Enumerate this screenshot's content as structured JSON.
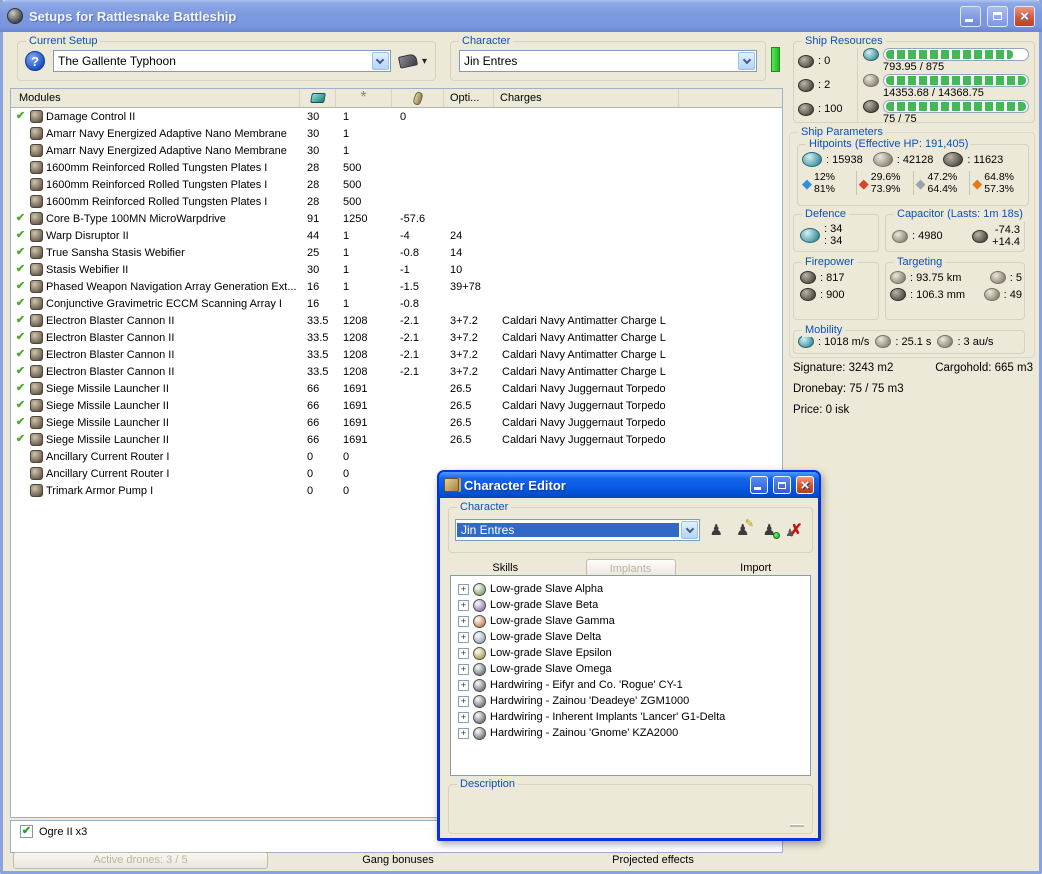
{
  "icons": {
    "help": "?",
    "dropdown_arrow": "▾",
    "fitted_check": "✔",
    "close_x": "×",
    "expander_plus": "+",
    "person": "♟",
    "edit_pencil": "✎",
    "delete_x": "✗",
    "resist_diamond": "◆"
  },
  "main_window": {
    "title": "Setups for Rattlesnake Battleship",
    "current_setup": {
      "label": "Current Setup",
      "value": "The Gallente Typhoon"
    },
    "character": {
      "label": "Character",
      "value": "Jin Entres"
    }
  },
  "modules_table": {
    "headers": {
      "name": "Modules",
      "opti": "Opti...",
      "charges": "Charges"
    },
    "rows": [
      {
        "checked": true,
        "name": "Damage Control II",
        "cpu": "30",
        "pg": "1",
        "cap": "0",
        "opti": "",
        "charge": ""
      },
      {
        "checked": false,
        "name": "Amarr Navy Energized Adaptive Nano Membrane",
        "cpu": "30",
        "pg": "1",
        "cap": "",
        "opti": "",
        "charge": ""
      },
      {
        "checked": false,
        "name": "Amarr Navy Energized Adaptive Nano Membrane",
        "cpu": "30",
        "pg": "1",
        "cap": "",
        "opti": "",
        "charge": ""
      },
      {
        "checked": false,
        "name": "1600mm Reinforced Rolled Tungsten Plates I",
        "cpu": "28",
        "pg": "500",
        "cap": "",
        "opti": "",
        "charge": ""
      },
      {
        "checked": false,
        "name": "1600mm Reinforced Rolled Tungsten Plates I",
        "cpu": "28",
        "pg": "500",
        "cap": "",
        "opti": "",
        "charge": ""
      },
      {
        "checked": false,
        "name": "1600mm Reinforced Rolled Tungsten Plates I",
        "cpu": "28",
        "pg": "500",
        "cap": "",
        "opti": "",
        "charge": ""
      },
      {
        "checked": true,
        "name": "Core B-Type 100MN MicroWarpdrive",
        "cpu": "91",
        "pg": "1250",
        "cap": "-57.6",
        "opti": "",
        "charge": ""
      },
      {
        "checked": true,
        "name": "Warp Disruptor II",
        "cpu": "44",
        "pg": "1",
        "cap": "-4",
        "opti": "24",
        "charge": ""
      },
      {
        "checked": true,
        "name": "True Sansha Stasis Webifier",
        "cpu": "25",
        "pg": "1",
        "cap": "-0.8",
        "opti": "14",
        "charge": ""
      },
      {
        "checked": true,
        "name": "Stasis Webifier II",
        "cpu": "30",
        "pg": "1",
        "cap": "-1",
        "opti": "10",
        "charge": ""
      },
      {
        "checked": true,
        "name": "Phased Weapon Navigation Array Generation Ext...",
        "cpu": "16",
        "pg": "1",
        "cap": "-1.5",
        "opti": "39+78",
        "charge": ""
      },
      {
        "checked": true,
        "name": "Conjunctive Gravimetric ECCM Scanning Array I",
        "cpu": "16",
        "pg": "1",
        "cap": "-0.8",
        "opti": "",
        "charge": ""
      },
      {
        "checked": true,
        "name": "Electron Blaster Cannon II",
        "cpu": "33.5",
        "pg": "1208",
        "cap": "-2.1",
        "opti": "3+7.2",
        "charge": "Caldari Navy Antimatter Charge L"
      },
      {
        "checked": true,
        "name": "Electron Blaster Cannon II",
        "cpu": "33.5",
        "pg": "1208",
        "cap": "-2.1",
        "opti": "3+7.2",
        "charge": "Caldari Navy Antimatter Charge L"
      },
      {
        "checked": true,
        "name": "Electron Blaster Cannon II",
        "cpu": "33.5",
        "pg": "1208",
        "cap": "-2.1",
        "opti": "3+7.2",
        "charge": "Caldari Navy Antimatter Charge L"
      },
      {
        "checked": true,
        "name": "Electron Blaster Cannon II",
        "cpu": "33.5",
        "pg": "1208",
        "cap": "-2.1",
        "opti": "3+7.2",
        "charge": "Caldari Navy Antimatter Charge L"
      },
      {
        "checked": true,
        "name": "Siege Missile Launcher II",
        "cpu": "66",
        "pg": "1691",
        "cap": "",
        "opti": "26.5",
        "charge": "Caldari Navy Juggernaut Torpedo"
      },
      {
        "checked": true,
        "name": "Siege Missile Launcher II",
        "cpu": "66",
        "pg": "1691",
        "cap": "",
        "opti": "26.5",
        "charge": "Caldari Navy Juggernaut Torpedo"
      },
      {
        "checked": true,
        "name": "Siege Missile Launcher II",
        "cpu": "66",
        "pg": "1691",
        "cap": "",
        "opti": "26.5",
        "charge": "Caldari Navy Juggernaut Torpedo"
      },
      {
        "checked": true,
        "name": "Siege Missile Launcher II",
        "cpu": "66",
        "pg": "1691",
        "cap": "",
        "opti": "26.5",
        "charge": "Caldari Navy Juggernaut Torpedo"
      },
      {
        "checked": false,
        "name": "Ancillary Current Router I",
        "cpu": "0",
        "pg": "0",
        "cap": "",
        "opti": "",
        "charge": ""
      },
      {
        "checked": false,
        "name": "Ancillary Current Router I",
        "cpu": "0",
        "pg": "0",
        "cap": "",
        "opti": "",
        "charge": ""
      },
      {
        "checked": false,
        "name": "Trimark Armor Pump I",
        "cpu": "0",
        "pg": "0",
        "cap": "",
        "opti": "",
        "charge": ""
      }
    ]
  },
  "ship_resources": {
    "title": "Ship Resources",
    "turrets": ": 0",
    "launchers": ": 2",
    "calibration": ": 100",
    "bars": [
      {
        "name": "cpu",
        "text": "793.95 / 875",
        "pct": 91
      },
      {
        "name": "powergrid",
        "text": "14353.68 / 14368.75",
        "pct": 100
      },
      {
        "name": "upgrades",
        "text": "75 / 75",
        "pct": 100
      }
    ]
  },
  "ship_parameters": {
    "title": "Ship Parameters",
    "hitpoints": {
      "title": "Hitpoints (Effective HP: 191,405)",
      "shield": ": 15938",
      "armor": ": 42128",
      "hull": ": 11623",
      "resists": [
        {
          "name": "em",
          "color": "#2f8fe0",
          "shield_pct": "12%",
          "armor_pct": "81%"
        },
        {
          "name": "thermal",
          "color": "#d5442c",
          "shield_pct": "29.6%",
          "armor_pct": "73.9%"
        },
        {
          "name": "kinetic",
          "color": "#9aa2ac",
          "shield_pct": "47.2%",
          "armor_pct": "64.4%"
        },
        {
          "name": "explosive",
          "color": "#e07b1f",
          "shield_pct": "64.8%",
          "armor_pct": "57.3%"
        }
      ]
    },
    "defence": {
      "title": "Defence",
      "top": ": 34",
      "bottom": ": 34"
    },
    "capacitor": {
      "title": "Capacitor (Lasts: 1m 18s)",
      "amount": ": 4980",
      "drain": "-74.3",
      "peak": "+14.4"
    },
    "firepower": {
      "title": "Firepower",
      "turret_dps": ": 817",
      "missile_dps": ": 900"
    },
    "targeting": {
      "title": "Targeting",
      "range": ": 93.75 km",
      "max_targets": ": 5",
      "scan_res": ": 106.3 mm",
      "sensor_strength": ": 49"
    },
    "mobility": {
      "title": "Mobility",
      "speed": ": 1018 m/s",
      "align": ": 25.1 s",
      "warp": ": 3 au/s"
    },
    "stats": {
      "signature": "Signature: 3243 m2",
      "cargohold": "Cargohold: 665 m3",
      "dronebay": "Dronebay: 75 / 75 m3",
      "price": "Price: 0 isk"
    }
  },
  "drones": {
    "items": [
      {
        "checked": true,
        "label": "Ogre II x3"
      }
    ]
  },
  "bottom_bar": {
    "active_drones": "Active drones: 3 / 5",
    "gang_bonuses": "Gang bonuses",
    "projected_effects": "Projected effects"
  },
  "character_editor": {
    "title": "Character Editor",
    "character": {
      "label": "Character",
      "value": "Jin Entres"
    },
    "tabs": {
      "skills": "Skills",
      "implants": "Implants",
      "import": "Import"
    },
    "implants": [
      {
        "label": "Low-grade Slave Alpha",
        "icon_color": "#8fae77"
      },
      {
        "label": "Low-grade Slave Beta",
        "icon_color": "#9d86b8"
      },
      {
        "label": "Low-grade Slave Gamma",
        "icon_color": "#c98f6d"
      },
      {
        "label": "Low-grade Slave Delta",
        "icon_color": "#9fb3c0"
      },
      {
        "label": "Low-grade Slave Epsilon",
        "icon_color": "#b3a96b"
      },
      {
        "label": "Low-grade Slave Omega",
        "icon_color": "#7d8288"
      },
      {
        "label": "Hardwiring - Eifyr and Co. 'Rogue' CY-1",
        "icon_color": "#7d8288"
      },
      {
        "label": "Hardwiring - Zainou 'Deadeye' ZGM1000",
        "icon_color": "#7d8288"
      },
      {
        "label": "Hardwiring - Inherent Implants 'Lancer' G1-Delta",
        "icon_color": "#7d8288"
      },
      {
        "label": "Hardwiring - Zainou 'Gnome' KZA2000",
        "icon_color": "#7d8288"
      }
    ],
    "description_label": "Description"
  }
}
